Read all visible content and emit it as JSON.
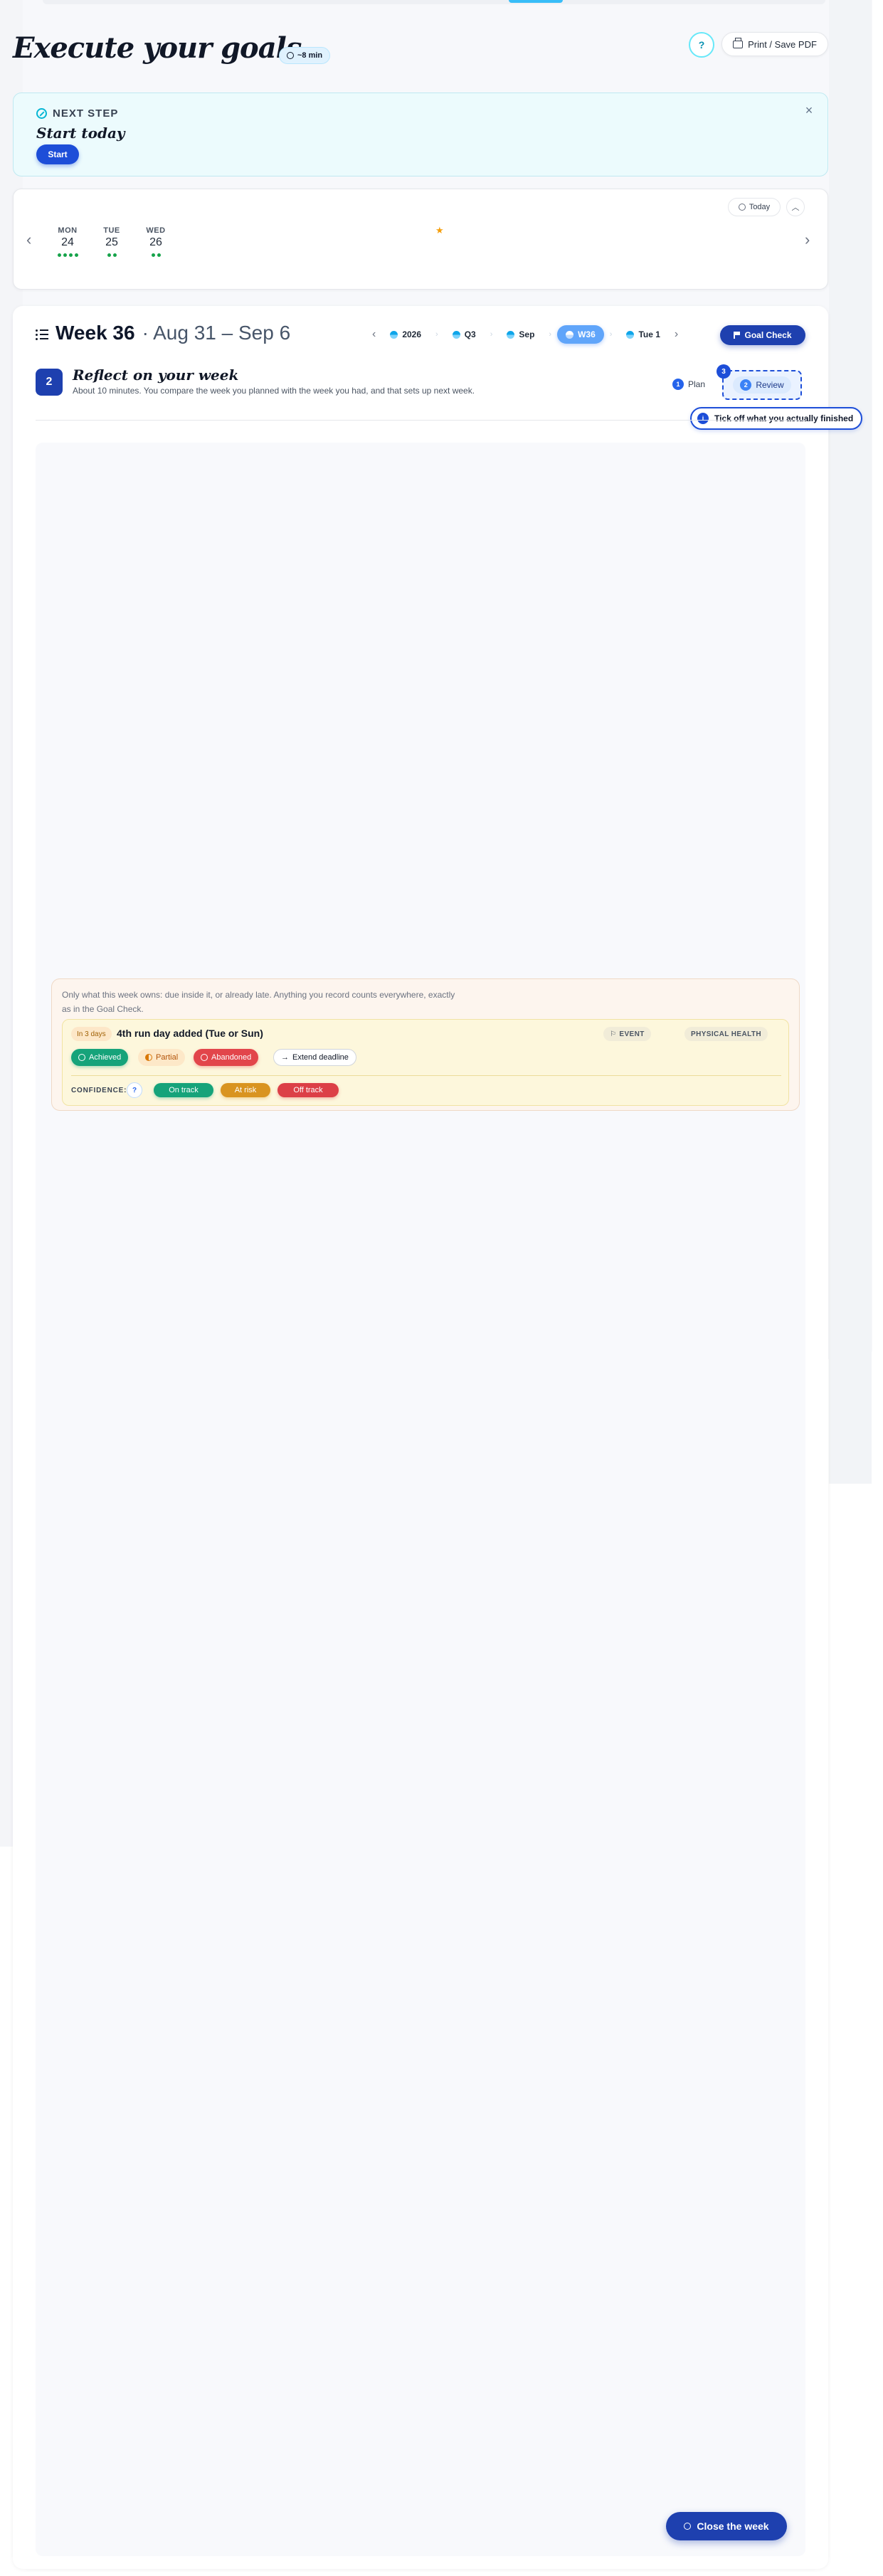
{
  "header": {
    "title": "Execute your goals",
    "time_badge": "~8 min",
    "help_label": "?",
    "print_label": "Print / Save PDF"
  },
  "next_step": {
    "eyebrow": "NEXT STEP",
    "headline": "Start today",
    "start_label": "Start",
    "close_label": "×"
  },
  "calendar": {
    "today_label": "Today",
    "days": [
      {
        "dow": "MON",
        "dom": "24",
        "dots": 4
      },
      {
        "dow": "TUE",
        "dom": "25",
        "dots": 2
      },
      {
        "dow": "WED",
        "dom": "26",
        "dots": 2
      }
    ]
  },
  "week": {
    "title": "Week 36",
    "range": "· Aug 31 – Sep 6",
    "breadcrumbs": [
      "2026",
      "Q3",
      "Sep",
      "W36",
      "Tue 1"
    ],
    "active_crumb": "W36",
    "goal_check_label": "Goal Check",
    "step": {
      "number": "2",
      "title": "Reflect on your week",
      "description": "About 10 minutes. You compare the week you planned with the week you had, and that sets up next week."
    },
    "tabs": {
      "plan": {
        "number": "1",
        "label": "Plan"
      },
      "review": {
        "number": "2",
        "label": "Review"
      }
    },
    "tour": {
      "badge": "3",
      "icon": "i",
      "text": "Tick off what you actually finished"
    }
  },
  "review_panel": {
    "note": "Only what this week owns: due inside it, or already late. Anything you record counts everywhere, exactly as in the Goal Check.",
    "item": {
      "due": "In 3 days",
      "title": "4th run day added (Tue or Sun)",
      "type_tag": "EVENT",
      "area_tag": "PHYSICAL HEALTH",
      "outcomes": {
        "achieved": "Achieved",
        "partial": "Partial",
        "abandoned": "Abandoned",
        "extend": "Extend deadline"
      },
      "confidence_label": "CONFIDENCE:",
      "confidence": {
        "on_track": "On track",
        "at_risk": "At risk",
        "off_track": "Off track"
      }
    }
  },
  "footer": {
    "close_week_label": "Close the week"
  },
  "colors": {
    "accent": "#1e40af",
    "success": "#16a37a",
    "warning": "#d99420",
    "danger": "#dc3f47"
  }
}
